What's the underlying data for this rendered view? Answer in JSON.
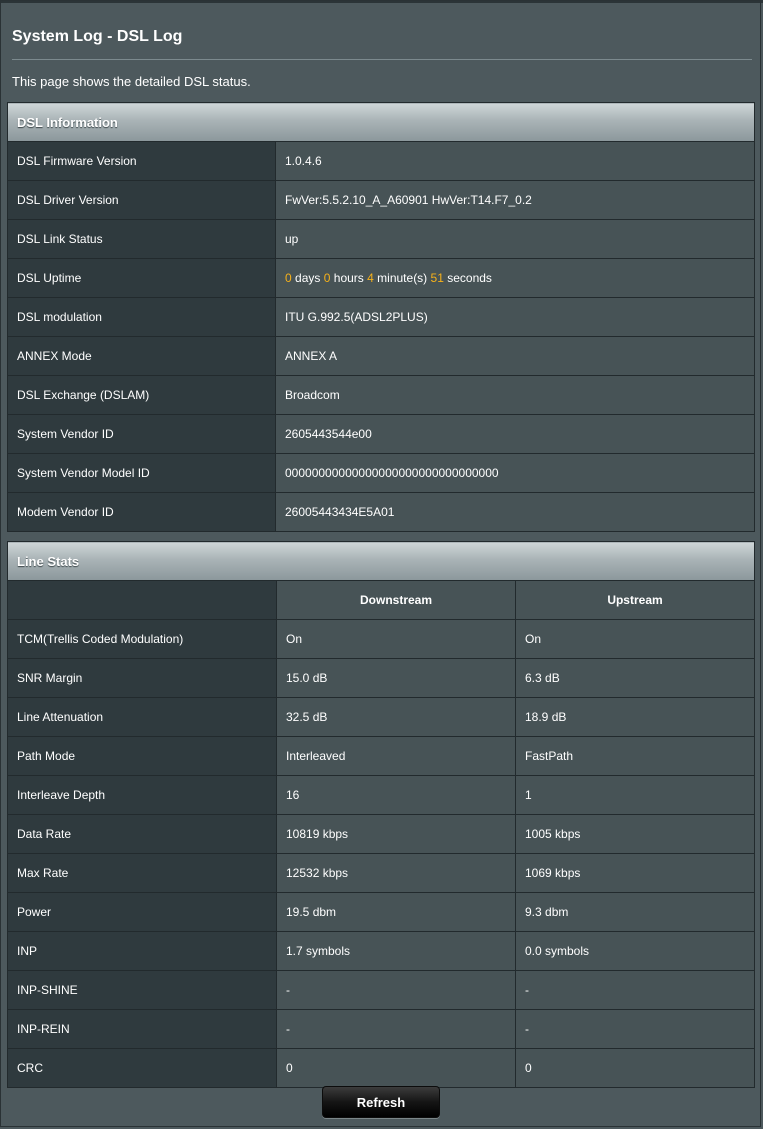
{
  "page": {
    "title": "System Log - DSL Log",
    "description": "This page shows the detailed DSL status."
  },
  "dsl_info": {
    "header": "DSL Information",
    "rows": [
      {
        "label": "DSL Firmware Version",
        "value": "1.0.4.6"
      },
      {
        "label": "DSL Driver Version",
        "value": "FwVer:5.5.2.10_A_A60901 HwVer:T14.F7_0.2"
      },
      {
        "label": "DSL Link Status",
        "value": "up"
      },
      {
        "label": "DSL Uptime",
        "value": ""
      },
      {
        "label": "DSL modulation",
        "value": "ITU G.992.5(ADSL2PLUS)"
      },
      {
        "label": "ANNEX Mode",
        "value": "ANNEX A"
      },
      {
        "label": "DSL Exchange (DSLAM)",
        "value": "Broadcom"
      },
      {
        "label": "System Vendor ID",
        "value": "2605443544e00"
      },
      {
        "label": "System Vendor Model ID",
        "value": "00000000000000000000000000000000"
      },
      {
        "label": "Modem Vendor ID",
        "value": "26005443434E5A01"
      }
    ],
    "uptime": {
      "days": "0",
      "days_unit": "days",
      "hours": "0",
      "hours_unit": "hours",
      "minutes": "4",
      "minutes_unit": "minute(s)",
      "seconds": "51",
      "seconds_unit": "seconds"
    }
  },
  "line_stats": {
    "header": "Line Stats",
    "columns": [
      "Downstream",
      "Upstream"
    ],
    "rows": [
      {
        "label": "TCM(Trellis Coded Modulation)",
        "down": "On",
        "up": "On"
      },
      {
        "label": "SNR Margin",
        "down": "15.0 dB",
        "up": "6.3 dB"
      },
      {
        "label": "Line Attenuation",
        "down": "32.5 dB",
        "up": "18.9 dB"
      },
      {
        "label": "Path Mode",
        "down": "Interleaved",
        "up": "FastPath"
      },
      {
        "label": "Interleave Depth",
        "down": "16",
        "up": "1"
      },
      {
        "label": "Data Rate",
        "down": "10819 kbps",
        "up": "1005 kbps"
      },
      {
        "label": "Max Rate",
        "down": "12532 kbps",
        "up": "1069 kbps"
      },
      {
        "label": "Power",
        "down": "19.5 dbm",
        "up": "9.3 dbm"
      },
      {
        "label": "INP",
        "down": "1.7 symbols",
        "up": "0.0 symbols"
      },
      {
        "label": "INP-SHINE",
        "down": "-",
        "up": "-"
      },
      {
        "label": "INP-REIN",
        "down": "-",
        "up": "-"
      },
      {
        "label": "CRC",
        "down": "0",
        "up": "0"
      }
    ]
  },
  "actions": {
    "refresh_label": "Refresh"
  },
  "colors": {
    "background": "#4d595d",
    "label_cell": "#2f3a3e",
    "value_cell": "#475356",
    "highlight": "#f6b11a"
  }
}
